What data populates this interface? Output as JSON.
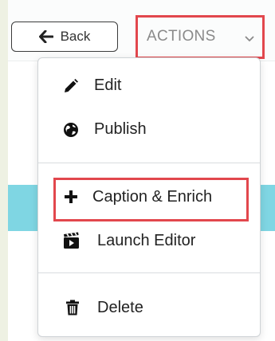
{
  "toolbar": {
    "back_label": "Back",
    "actions_label": "ACTIONS"
  },
  "icons": {
    "back": "arrow-left-icon",
    "actions_chevron": "chevron-down-icon",
    "edit": "pencil-icon",
    "publish": "globe-icon",
    "caption": "plus-icon",
    "launch": "clapperboard-icon",
    "delete": "trash-icon"
  },
  "dropdown": {
    "items": [
      {
        "label": "Edit"
      },
      {
        "label": "Publish"
      },
      {
        "label": "Caption & Enrich"
      },
      {
        "label": "Launch Editor"
      },
      {
        "label": "Delete"
      }
    ]
  },
  "colors": {
    "highlight": "#e2474d",
    "cyan_band": "#7fd6e3",
    "side_strip": "#eef1e3"
  }
}
